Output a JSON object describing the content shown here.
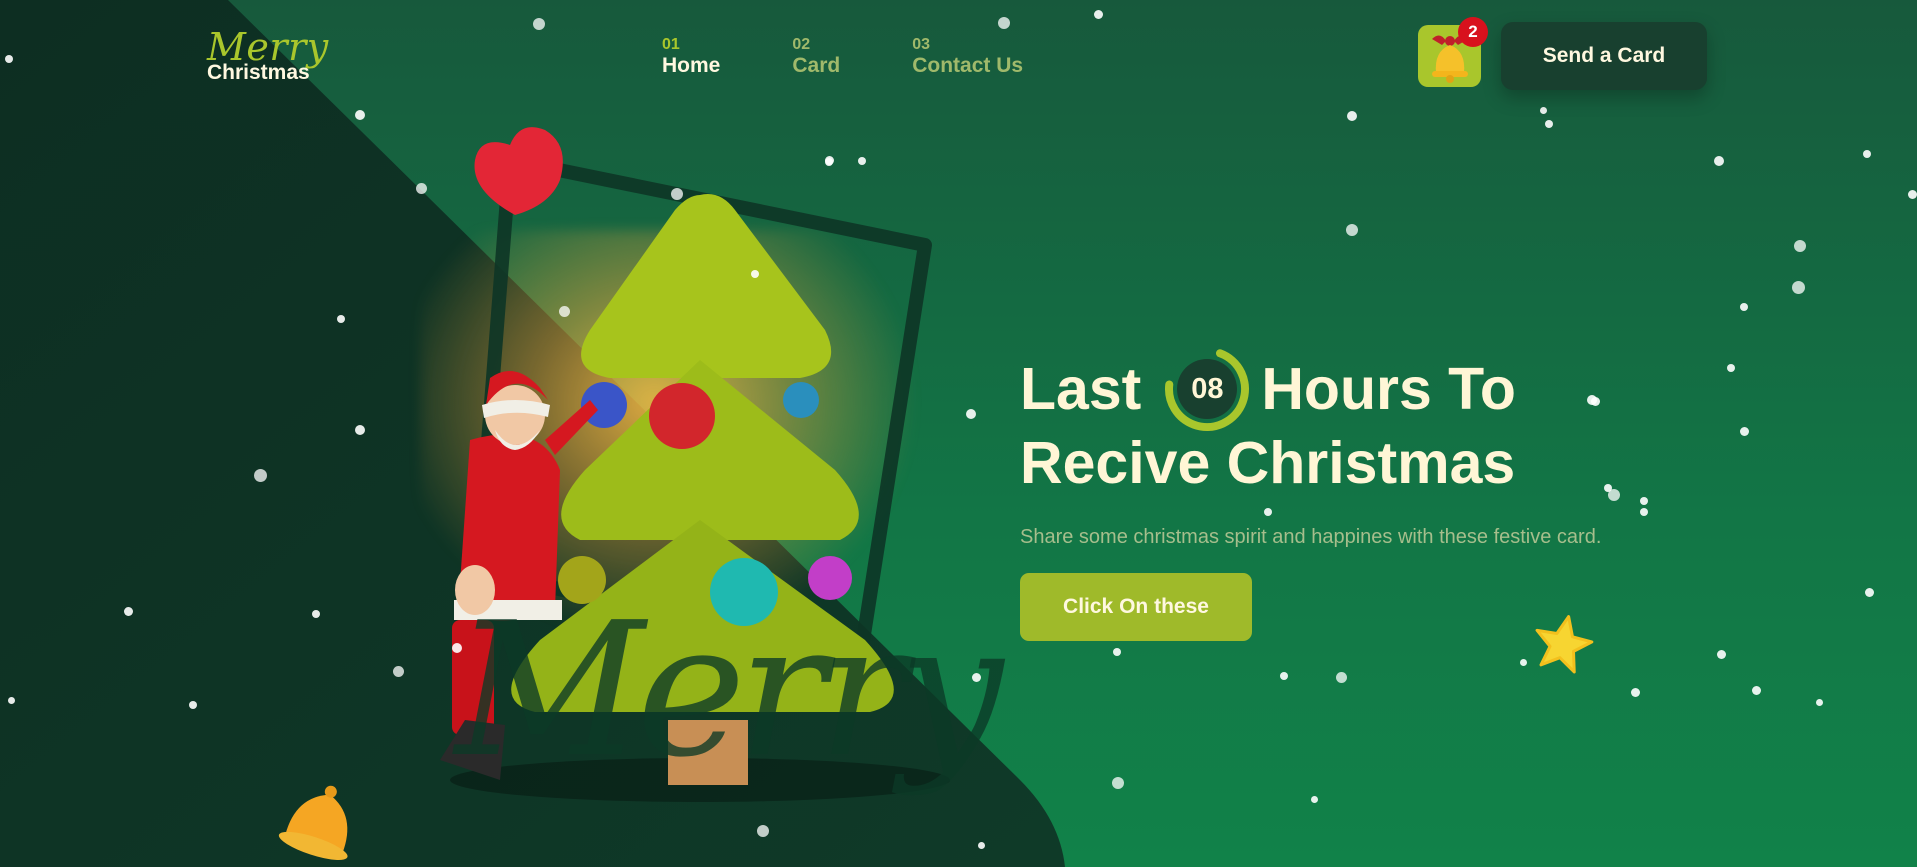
{
  "logo": {
    "script": "Merry",
    "sub": "Christmas"
  },
  "nav": [
    {
      "num": "01",
      "label": "Home",
      "active": true
    },
    {
      "num": "02",
      "label": "Card",
      "active": false
    },
    {
      "num": "03",
      "label": "Contact Us",
      "active": false
    }
  ],
  "header": {
    "notification_count": "2",
    "send_button_label": "Send a Card"
  },
  "hero": {
    "title_word1": "Last",
    "countdown_value": "08",
    "title_word2": "Hours To",
    "title_line2": "Recive Christmas",
    "description": "Share some christmas spirit and happines with these festive card.",
    "cta_label": "Click On these"
  },
  "decor_text": {
    "merry_script": "Merry"
  },
  "colors": {
    "accent": "#a9c62c",
    "dark_green": "#18402f",
    "cream": "#fff6d6",
    "badge_red": "#d8111d",
    "cta_green": "#9fba2a"
  },
  "icons": [
    "bell-icon",
    "heart-decor-icon",
    "star-decor-icon",
    "bell-decor-icon"
  ]
}
